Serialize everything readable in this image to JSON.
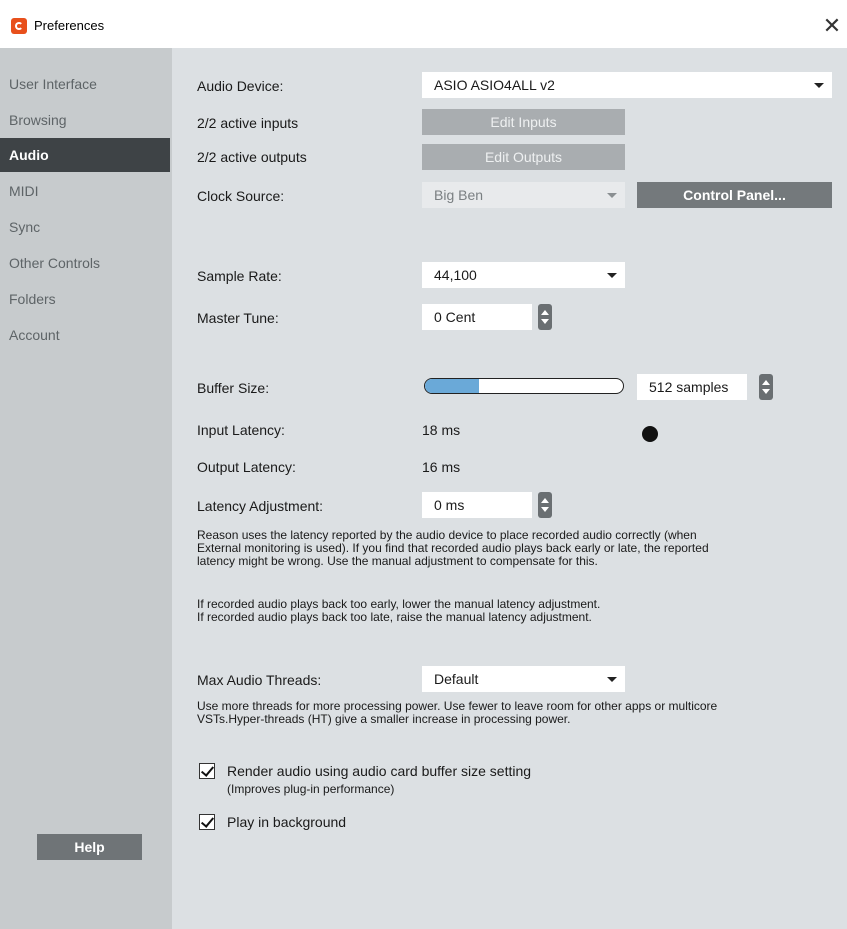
{
  "window": {
    "title": "Preferences",
    "close_glyph": "✕"
  },
  "sidebar": {
    "items": [
      {
        "label": "User Interface"
      },
      {
        "label": "Browsing"
      },
      {
        "label": "Audio",
        "active": true
      },
      {
        "label": "MIDI"
      },
      {
        "label": "Sync"
      },
      {
        "label": "Other Controls"
      },
      {
        "label": "Folders"
      },
      {
        "label": "Account"
      }
    ],
    "help_label": "Help"
  },
  "audio": {
    "device_label": "Audio Device:",
    "device_value": "ASIO ASIO4ALL v2",
    "inputs_label": "2/2 active inputs",
    "edit_inputs_label": "Edit Inputs",
    "outputs_label": "2/2 active outputs",
    "edit_outputs_label": "Edit Outputs",
    "clock_label": "Clock Source:",
    "clock_value": "Big Ben",
    "control_panel_label": "Control Panel...",
    "sample_rate_label": "Sample Rate:",
    "sample_rate_value": "44,100",
    "master_tune_label": "Master Tune:",
    "master_tune_value": "0 Cent",
    "buffer_label": "Buffer Size:",
    "buffer_value": "512 samples",
    "buffer_slider_fraction": 0.27,
    "input_latency_label": "Input Latency:",
    "input_latency_value": "18 ms",
    "output_latency_label": "Output Latency:",
    "output_latency_value": "16 ms",
    "latency_adj_label": "Latency Adjustment:",
    "latency_adj_value": "0 ms",
    "latency_help": [
      "Reason uses the latency reported by the audio device to place recorded audio correctly (when",
      "External monitoring is used). If you find that recorded audio plays back early or late, the reported",
      "latency might be wrong. Use the manual adjustment to compensate for this."
    ],
    "latency_hint": [
      "If recorded audio plays back too early, lower the manual latency adjustment.",
      "If recorded audio plays back too late, raise the manual latency adjustment."
    ],
    "threads_label": "Max Audio Threads:",
    "threads_value": "Default",
    "threads_help": [
      "Use more threads for more processing power. Use fewer to leave room for other apps or multicore",
      "VSTs.Hyper-threads (HT) give a smaller increase in processing power."
    ],
    "render_checkbox_label": "Render audio using audio card buffer size setting",
    "render_checkbox_sub": "(Improves plug-in performance)",
    "render_checked": true,
    "background_checkbox_label": "Play in background",
    "background_checked": true
  },
  "colors": {
    "accent_blue": "#6aa9d8",
    "sidebar_active": "#3e4346",
    "app_icon": "#e8501c"
  }
}
